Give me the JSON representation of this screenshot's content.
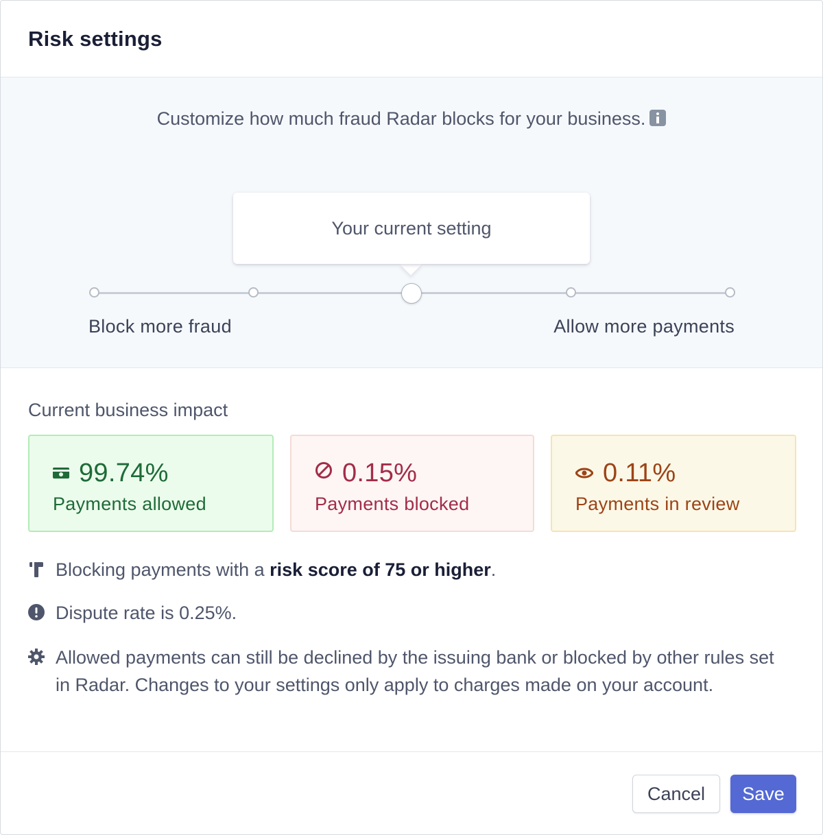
{
  "dialog": {
    "title": "Risk settings"
  },
  "risk_panel": {
    "intro": "Customize how much fraud Radar blocks for your business.",
    "tooltip": "Your current setting",
    "slider": {
      "stops": 5,
      "current_stop": 3,
      "left_label": "Block more fraud",
      "right_label": "Allow more payments"
    }
  },
  "impact": {
    "heading": "Current business impact",
    "cards": [
      {
        "value": "99.74%",
        "label": "Payments allowed",
        "icon": "cash-icon",
        "color": "#1e6b38"
      },
      {
        "value": "0.15%",
        "label": "Payments blocked",
        "icon": "blocked-icon",
        "color": "#a32c48"
      },
      {
        "value": "0.11%",
        "label": "Payments in review",
        "icon": "eye-icon",
        "color": "#9c4416"
      }
    ]
  },
  "notes": {
    "blocking": {
      "prefix": "Blocking payments with a ",
      "emphasis": "risk score of 75 or higher",
      "suffix": ".",
      "icon": "gavel-icon"
    },
    "dispute": {
      "text": "Dispute rate is 0.25%.",
      "icon": "alert-icon"
    },
    "allowed": {
      "text": "Allowed payments can still be declined by the issuing bank or blocked by other rules set in Radar. Changes to your settings only apply to charges made on your account.",
      "icon": "gear-icon"
    }
  },
  "footer": {
    "cancel_label": "Cancel",
    "save_label": "Save",
    "accent": "#5469d4"
  }
}
